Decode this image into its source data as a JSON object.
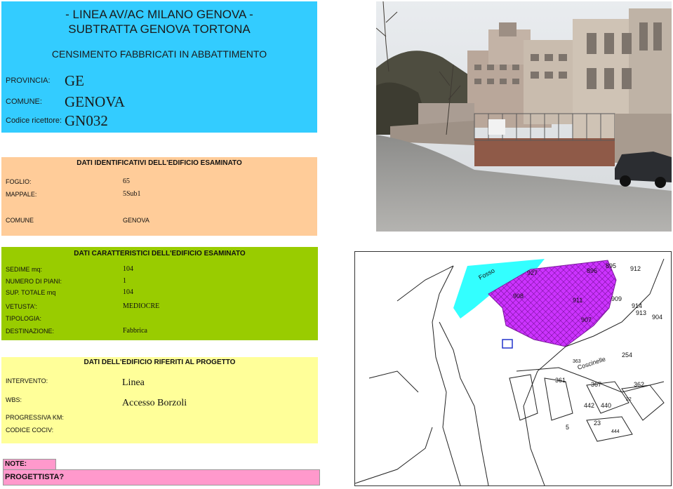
{
  "header": {
    "title_line1": "- LINEA AV/AC MILANO    GENOVA -",
    "title_line2": "SUBTRATTA GENOVA TORTONA",
    "subtitle": "CENSIMENTO FABBRICATI IN ABBATTIMENTO",
    "provincia_label": "PROVINCIA:",
    "provincia_value": "GE",
    "comune_label": "COMUNE:",
    "comune_value": "GENOVA",
    "codice_label": "Codice ricettore:",
    "codice_value": "GN032"
  },
  "identificativi": {
    "title": "DATI IDENTIFICATIVI DELL'EDIFICIO ESAMINATO",
    "foglio_label": "FOGLIO:",
    "foglio_value": "65",
    "mappale_label": "MAPPALE:",
    "mappale_value": "5Sub1",
    "comune_label": "COMUNE",
    "comune_value": "GENOVA"
  },
  "caratteristici": {
    "title": "DATI CARATTERISTICI DELL'EDIFICIO ESAMINATO",
    "sedime_label": "SEDIME mq:",
    "sedime_value": "104",
    "piani_label": "NUMERO DI PIANI:",
    "piani_value": "1",
    "sup_label": "SUP. TOTALE mq",
    "sup_value": "104",
    "vetusta_label": "VETUSTA':",
    "vetusta_value": "MEDIOCRE",
    "tipologia_label": "TIPOLOGIA:",
    "destinazione_label": "DESTINAZIONE:",
    "destinazione_value": "Fabbrica"
  },
  "progetto": {
    "title": "DATI DELL'EDIFICIO RIFERITI AL PROGETTO",
    "intervento_label": "INTERVENTO:",
    "intervento_value": "Linea",
    "wbs_label": "WBS:",
    "wbs_value": "Accesso Borzoli",
    "progressiva_label": "PROGRESSIVA KM:",
    "codice_cociv_label": "CODICE COCIV:"
  },
  "notes": {
    "note_label": "NOTE:",
    "progettista_label": "PROGETTISTA?"
  },
  "map": {
    "labels": {
      "fosso": "Fosso",
      "coscinelle": "Coscinelle",
      "p895": "895",
      "p896": "896",
      "p912": "912",
      "p927": "927",
      "p908": "908",
      "p911": "911",
      "p909": "909",
      "p914": "914",
      "p913": "913",
      "p904": "904",
      "p907": "907",
      "p254": "254",
      "p363": "363",
      "p361": "361",
      "p367": "367",
      "p362": "362",
      "p442": "442",
      "p440": "440",
      "p22": "22",
      "p5": "5",
      "p23": "23",
      "p444": "444"
    }
  },
  "colors": {
    "header_bg": "#33ccff",
    "ident_bg": "#ffcc99",
    "char_bg": "#99cc00",
    "proj_bg": "#ffff99",
    "note_bg": "#ff99cc",
    "map_area": "#cc33ff",
    "map_water": "#33ffff"
  }
}
